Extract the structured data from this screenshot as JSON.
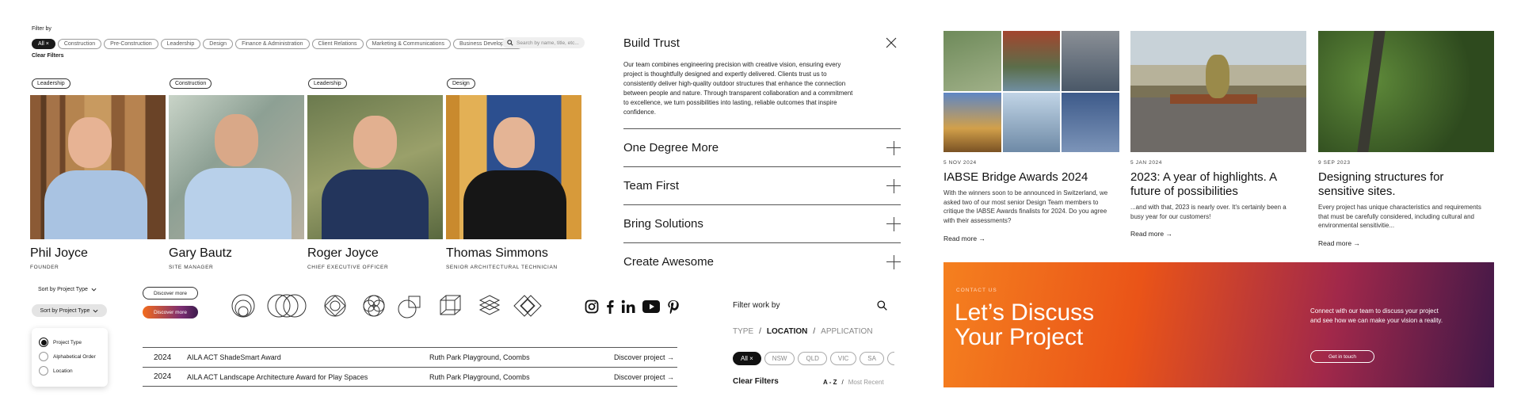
{
  "filters": {
    "label": "Filter by",
    "chips": [
      "All ×",
      "Construction",
      "Pre-Construction",
      "Leadership",
      "Design",
      "Finance & Administration",
      "Client Relations",
      "Marketing & Communications",
      "Business Development"
    ],
    "search_placeholder": "Search by name, title, etc...",
    "clear": "Clear Filters"
  },
  "people": [
    {
      "tag": "Leadership",
      "name": "Phil Joyce",
      "role": "FOUNDER"
    },
    {
      "tag": "Construction",
      "name": "Gary Bautz",
      "role": "SITE MANAGER"
    },
    {
      "tag": "Leadership",
      "name": "Roger Joyce",
      "role": "CHIEF EXECUTIVE OFFICER"
    },
    {
      "tag": "Design",
      "name": "Thomas Simmons",
      "role": "SENIOR ARCHITECTURAL TECHNICIAN"
    }
  ],
  "values_panel": {
    "title": "Build Trust",
    "body": "Our team combines engineering precision with creative vision, ensuring every project is thoughtfully designed and expertly delivered. Clients trust us to consistently deliver high-quality outdoor structures that enhance the connection between people and nature. Through transparent collaboration and a commitment to excellence, we turn possibilities into lasting, reliable outcomes that inspire confidence.",
    "items": [
      "One Degree More",
      "Team First",
      "Bring Solutions",
      "Create Awesome"
    ]
  },
  "controls": {
    "sort1": "Sort by Project Type",
    "sort2": "Sort by Project Type",
    "discover1": "Discover more",
    "discover2": "Discover more",
    "sort_options": [
      "Project Type",
      "Alphabetical Order",
      "Location"
    ]
  },
  "awards": [
    {
      "year": "2024",
      "title": "AILA ACT ShadeSmart Award",
      "project": "Ruth Park Playground, Coombs",
      "link": "Discover project"
    },
    {
      "year": "2024",
      "title": "AILA ACT Landscape Architecture Award for Play Spaces",
      "project": "Ruth Park Playground, Coombs",
      "link": "Discover project"
    }
  ],
  "work_filter": {
    "label": "Filter work by",
    "modes": [
      "TYPE",
      "LOCATION",
      "APPLICATION"
    ],
    "chips": [
      "All ×",
      "NSW",
      "QLD",
      "VIC",
      "SA"
    ],
    "clear": "Clear Filters",
    "sort_a": "A - Z",
    "sort_b": "Most Recent"
  },
  "news": [
    {
      "date": "5 NOV 2024",
      "title": "IABSE Bridge Awards 2024",
      "body": "With the winners soon to be announced in Switzerland, we asked two of our most senior Design Team members to critique the IABSE Awards finalists for 2024. Do you agree with their assessments?",
      "more": "Read more"
    },
    {
      "date": "5 JAN 2024",
      "title": "2023: A year of highlights. A future of possibilities",
      "body": "...and with that, 2023 is nearly over. It's certainly been a busy year for our customers!",
      "more": "Read more"
    },
    {
      "date": "9 SEP 2023",
      "title": "Designing structures for sensitive sites.",
      "body": "Every project has unique characteristics and requirements that must be carefully considered, including cultural and environmental sensitivitie...",
      "more": "Read more"
    }
  ],
  "cta": {
    "kicker": "CONTACT US",
    "title_line1": "Let’s Discuss",
    "title_line2": "Your Project",
    "body": "Connect with our team to discuss your project and see how we can make your vision a reality.",
    "button": "Get in touch"
  }
}
